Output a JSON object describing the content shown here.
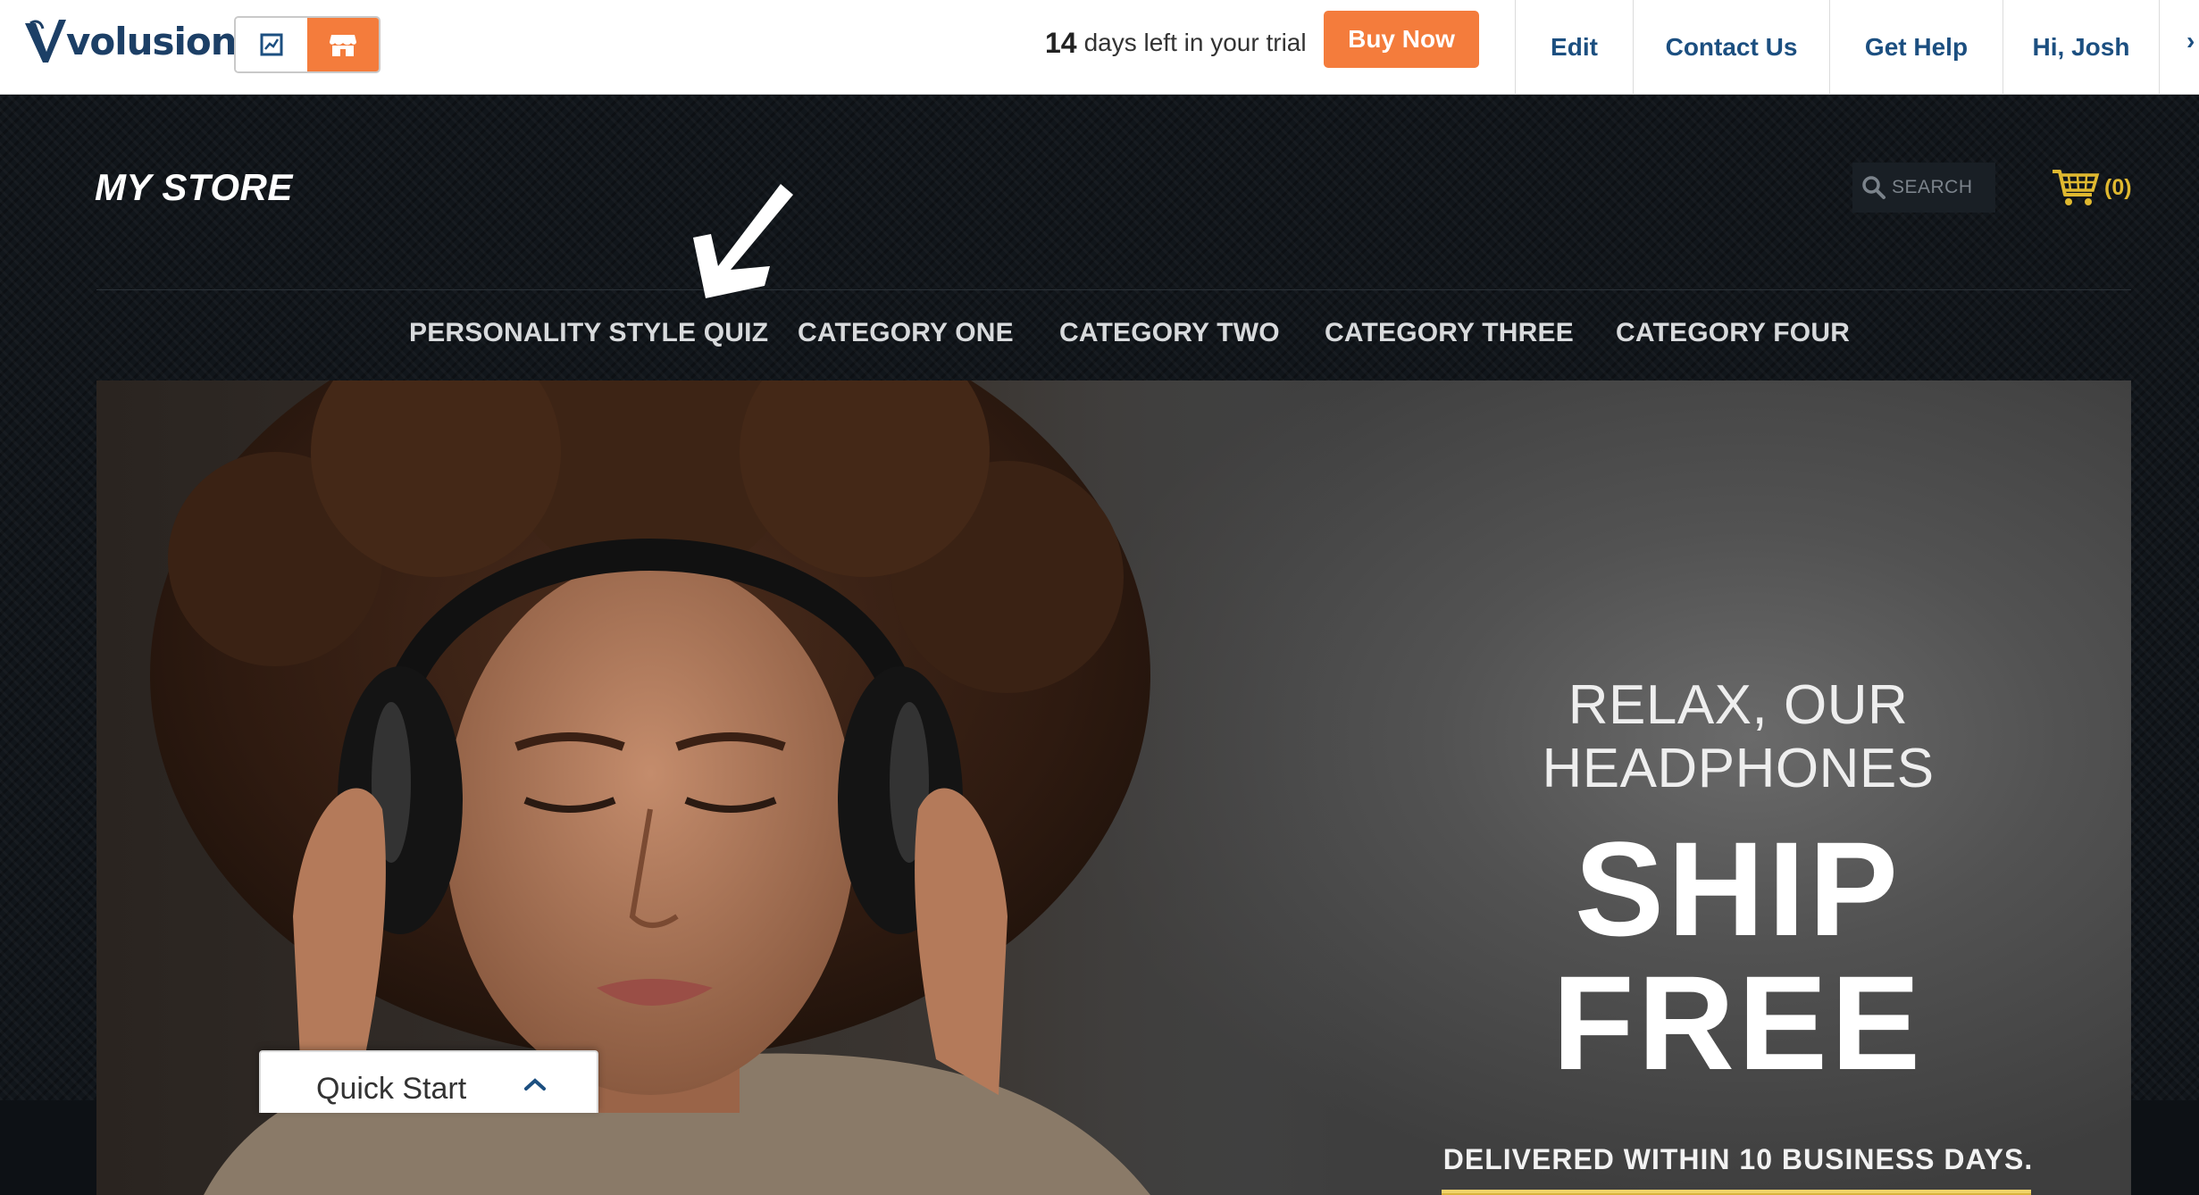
{
  "admin_bar": {
    "logo_text": "volusion",
    "logo_mark": "®",
    "trial_days": "14",
    "trial_text": "days left in your trial",
    "buy_now": "Buy Now",
    "links": {
      "edit": "Edit",
      "contact": "Contact Us",
      "help": "Get Help",
      "user": "Hi, Josh"
    },
    "more": "›"
  },
  "store": {
    "name": "MY STORE",
    "search_placeholder": "SEARCH",
    "cart_count": "(0)",
    "nav": [
      "PERSONALITY STYLE QUIZ",
      "CATEGORY ONE",
      "CATEGORY TWO",
      "CATEGORY THREE",
      "CATEGORY FOUR"
    ]
  },
  "hero": {
    "subtitle": "RELAX, OUR HEADPHONES",
    "headline": "SHIP FREE",
    "note": "DELIVERED WITHIN 10 BUSINESS DAYS."
  },
  "quick_start": {
    "label": "Quick Start"
  },
  "colors": {
    "accent_orange": "#f47c3c",
    "link_blue": "#1c4f80",
    "cart_gold": "#e0b930"
  },
  "icons": [
    "volusion-logo-icon",
    "dashboard-chart-icon",
    "storefront-icon",
    "search-icon",
    "cart-icon",
    "chevron-up-icon",
    "annotation-arrow-icon"
  ]
}
